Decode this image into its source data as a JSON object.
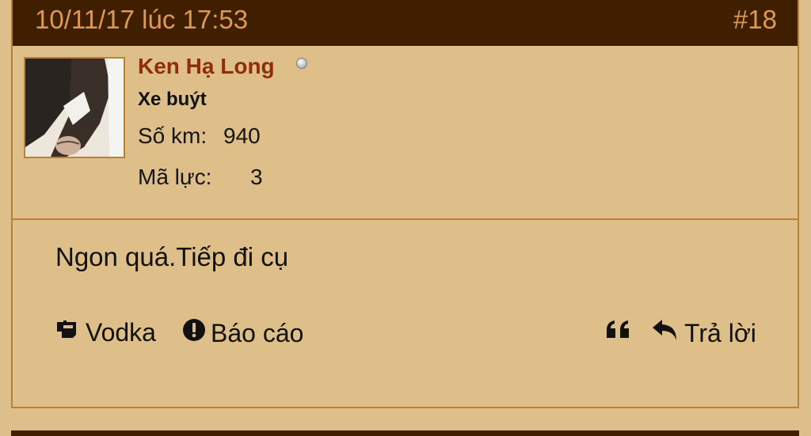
{
  "post": {
    "date": "10/11/17 lúc 17:53",
    "number": "#18"
  },
  "user": {
    "name": "Ken Hạ Long",
    "title": "Xe buýt",
    "stats": {
      "km_label": "Số km:",
      "km_value": "940",
      "hp_label": "Mã lực:",
      "hp_value": "3"
    },
    "online_icon": "status-dot-icon"
  },
  "message": {
    "text": "Ngon quá.Tiếp đi cụ"
  },
  "actions": {
    "vodka_label": "Vodka",
    "report_label": "Báo cáo",
    "reply_label": "Trả lời"
  },
  "colors": {
    "header_bg": "#3F1F00",
    "header_text": "#DD9A57",
    "post_bg": "#DFBF89",
    "border": "#B88136",
    "username": "#8F2E0A"
  }
}
